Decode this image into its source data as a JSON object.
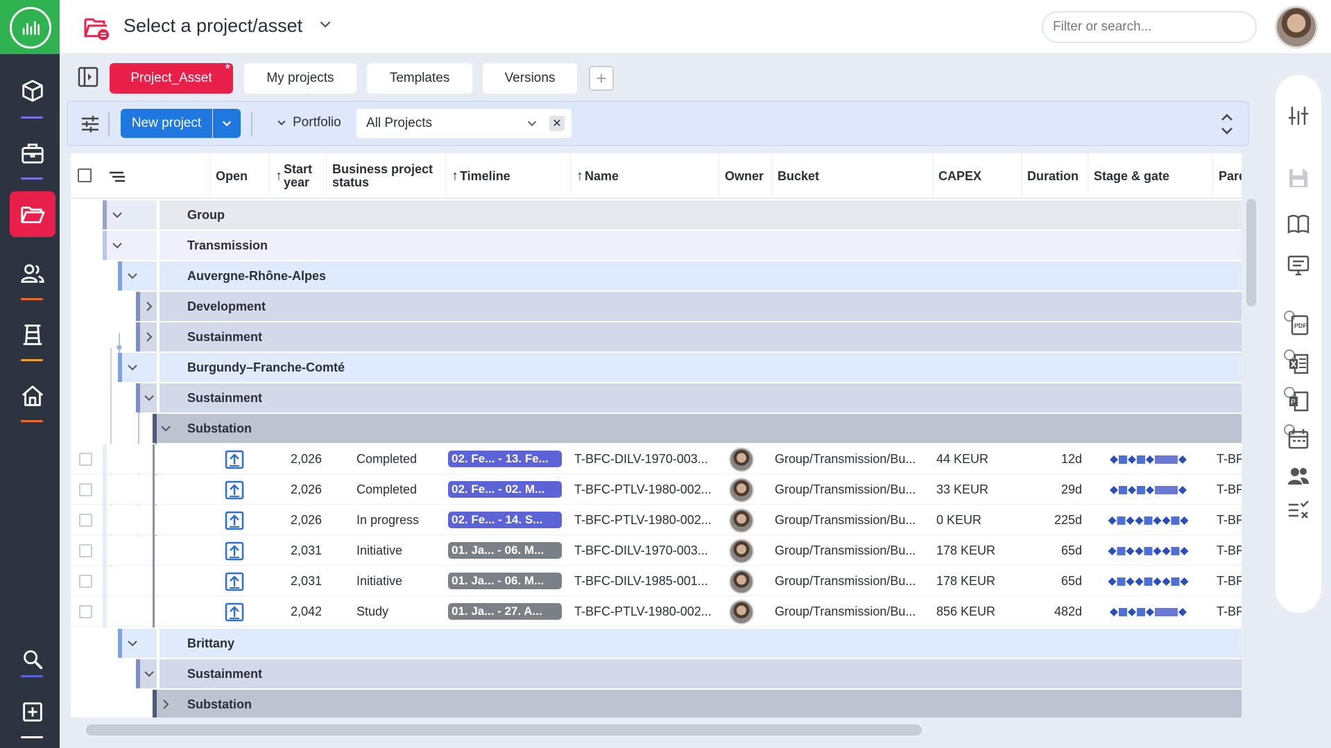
{
  "header": {
    "project_title": "Select a project/asset",
    "search_placeholder": "Filter or search..."
  },
  "tabs": [
    {
      "label": "Project_Asset",
      "active": true,
      "modified_marker": "*"
    },
    {
      "label": "My projects"
    },
    {
      "label": "Templates"
    },
    {
      "label": "Versions"
    }
  ],
  "toolbar": {
    "new_project_label": "New project",
    "portfolio_label": "Portfolio",
    "portfolio_value": "All Projects",
    "clear_label": "✕"
  },
  "columns": [
    {
      "label": "Open"
    },
    {
      "label": "Start year",
      "sorted": true
    },
    {
      "label": "Business project status"
    },
    {
      "label": "Timeline",
      "sorted": true
    },
    {
      "label": "Name",
      "sorted": true
    },
    {
      "label": "Owner"
    },
    {
      "label": "Bucket"
    },
    {
      "label": "CAPEX"
    },
    {
      "label": "Duration"
    },
    {
      "label": "Stage & gate"
    },
    {
      "label": "Pare"
    }
  ],
  "groups": {
    "group": "Group",
    "transmission": "Transmission",
    "arra": "Auvergne-Rhône-Alpes",
    "arra_dev": "Development",
    "arra_sus": "Sustainment",
    "bfc": "Burgundy–Franche-Comté",
    "bfc_sus": "Sustainment",
    "bfc_sub": "Substation",
    "brittany": "Brittany",
    "brit_sus": "Sustainment",
    "brit_sub": "Substation"
  },
  "rows": [
    {
      "year": "2,026",
      "status": "Completed",
      "timeline": "02. Fe...  -  13. Fe...",
      "timeline_color": "#5b63d6",
      "name": "T-BFC-DILV-1970-003...",
      "bucket": "Group/Transmission/Bu...",
      "capex": "44 KEUR",
      "duration": "12d",
      "parent": "T-BF"
    },
    {
      "year": "2,026",
      "status": "Completed",
      "timeline": "02. Fe...  -  02. M...",
      "timeline_color": "#5b63d6",
      "name": "T-BFC-PTLV-1980-002...",
      "bucket": "Group/Transmission/Bu...",
      "capex": "33 KEUR",
      "duration": "29d",
      "parent": "T-BF"
    },
    {
      "year": "2,026",
      "status": "In progress",
      "timeline": "02. Fe...  -  14. S...",
      "timeline_color": "#5b63d6",
      "name": "T-BFC-PTLV-1980-002...",
      "bucket": "Group/Transmission/Bu...",
      "capex": "0 KEUR",
      "duration": "225d",
      "parent": "T-BF"
    },
    {
      "year": "2,031",
      "status": "Initiative",
      "timeline": "01. Ja...  -  06. M...",
      "timeline_color": "#7b7f86",
      "name": "T-BFC-DILV-1970-003...",
      "bucket": "Group/Transmission/Bu...",
      "capex": "178 KEUR",
      "duration": "65d",
      "parent": "T-BF"
    },
    {
      "year": "2,031",
      "status": "Initiative",
      "timeline": "01. Ja...  -  06. M...",
      "timeline_color": "#7b7f86",
      "name": "T-BFC-DILV-1985-001...",
      "bucket": "Group/Transmission/Bu...",
      "capex": "178 KEUR",
      "duration": "65d",
      "parent": "T-BF"
    },
    {
      "year": "2,042",
      "status": "Study",
      "timeline": "01. Ja...  -  27. A...",
      "timeline_color": "#7b7f86",
      "name": "T-BFC-PTLV-1980-002...",
      "bucket": "Group/Transmission/Bu...",
      "capex": "856 KEUR",
      "duration": "482d",
      "parent": "T-BF"
    }
  ],
  "colors": {
    "accent": "#e8204a",
    "primary": "#1f78e0",
    "brand_green": "#2fb351",
    "nav_bg": "#2c3440"
  }
}
